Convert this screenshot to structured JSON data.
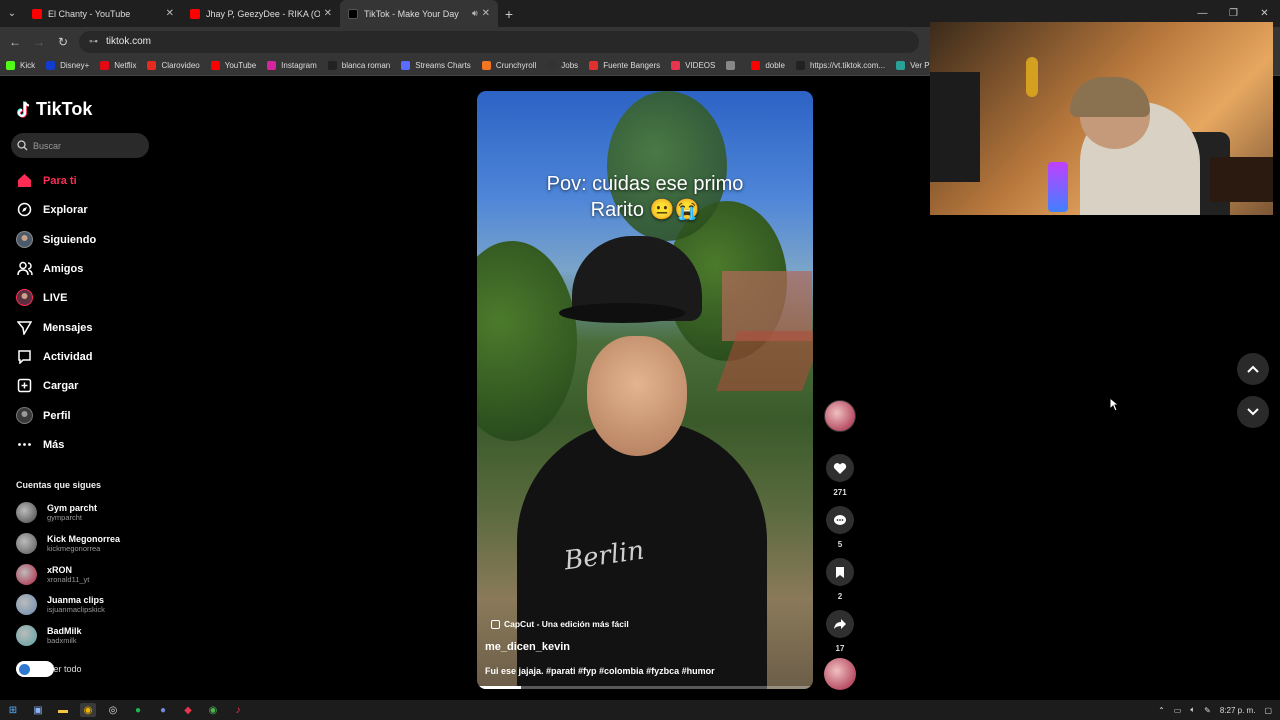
{
  "browser": {
    "tabs": [
      {
        "title": "El Chanty - YouTube",
        "color": "#ff0000",
        "active": false
      },
      {
        "title": "Jhay P, GeezyDee - RIKA (Offici",
        "color": "#ff0000",
        "active": false
      },
      {
        "title": "TikTok - Make Your Day",
        "color": "#000000",
        "active": true
      }
    ],
    "url": "tiktok.com",
    "bookmarks": [
      {
        "label": "Kick",
        "color": "#53fc18"
      },
      {
        "label": "Disney+",
        "color": "#113ccf"
      },
      {
        "label": "Netflix",
        "color": "#e50914"
      },
      {
        "label": "Clarovideo",
        "color": "#e52b20"
      },
      {
        "label": "YouTube",
        "color": "#ff0000"
      },
      {
        "label": "Instagram",
        "color": "#d6249f"
      },
      {
        "label": "blanca roman",
        "color": "#222222"
      },
      {
        "label": "Streams Charts",
        "color": "#5a6cff"
      },
      {
        "label": "Crunchyroll",
        "color": "#f47521"
      },
      {
        "label": "Jobs",
        "color": "#333333"
      },
      {
        "label": "Fuente Bangers",
        "color": "#e03030"
      },
      {
        "label": "VIDEOS",
        "color": "#e8344e"
      },
      {
        "label": "",
        "color": "#888888"
      },
      {
        "label": "doble",
        "color": "#ff0000"
      },
      {
        "label": "https://vt.tiktok.com...",
        "color": "#222222"
      },
      {
        "label": "Ver Pa",
        "color": "#2aa198"
      }
    ]
  },
  "tiktok": {
    "logo": "TikTok",
    "search_placeholder": "Buscar",
    "nav": [
      {
        "label": "Para ti",
        "icon": "home-icon",
        "active": true
      },
      {
        "label": "Explorar",
        "icon": "compass-icon",
        "active": false
      },
      {
        "label": "Siguiendo",
        "icon": "following-avatar-icon",
        "active": false
      },
      {
        "label": "Amigos",
        "icon": "friends-icon",
        "active": false
      },
      {
        "label": "LIVE",
        "icon": "live-icon",
        "active": false
      },
      {
        "label": "Mensajes",
        "icon": "send-icon",
        "active": false
      },
      {
        "label": "Actividad",
        "icon": "activity-icon",
        "active": false
      },
      {
        "label": "Cargar",
        "icon": "upload-icon",
        "active": false
      },
      {
        "label": "Perfil",
        "icon": "profile-icon",
        "active": false
      },
      {
        "label": "Más",
        "icon": "more-icon",
        "active": false
      }
    ],
    "following_title": "Cuentas que sigues",
    "following": [
      {
        "name": "Gym parcht",
        "handle": "gymparcht",
        "color": "#444444"
      },
      {
        "name": "Kick Megonorrea",
        "handle": "kickmegonorrea",
        "color": "#555555"
      },
      {
        "name": "xRON",
        "handle": "xronald11_yt",
        "color": "#b02040"
      },
      {
        "name": "Juanma clips",
        "handle": "isjuanmaclipskick",
        "color": "#6a8ab0"
      },
      {
        "name": "BadMilk",
        "handle": "badxmilk",
        "color": "#5aa0a0"
      }
    ],
    "see_all": "Ver todo",
    "video": {
      "overlay_line1": "Pov: cuidas ese primo",
      "overlay_line2": "Rarito 😐😭",
      "capcut": "CapCut - Una edición más fácil",
      "username": "me_dicen_kevin",
      "description": "Fui ese jajaja. #parati #fyp #colombia #fyzbca #humor",
      "shirt_text": "Berlin",
      "progress": 0.13
    },
    "actions": {
      "likes": "271",
      "comments": "5",
      "saves": "2",
      "shares": "17"
    }
  },
  "taskbar": {
    "time": "8:27 p. m."
  }
}
